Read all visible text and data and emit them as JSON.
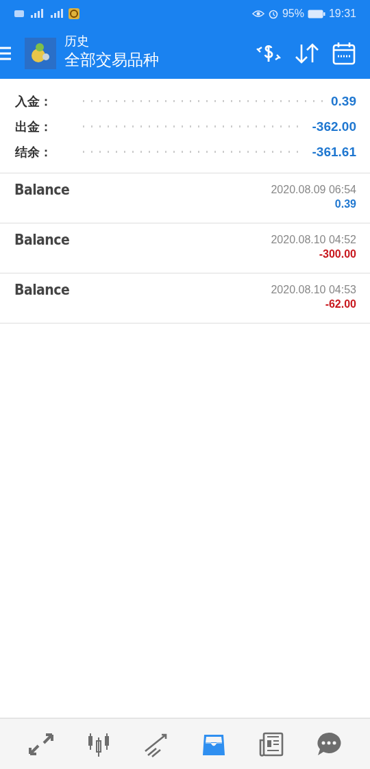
{
  "status_bar": {
    "battery": "95%",
    "time": "19:31"
  },
  "header": {
    "title": "历史",
    "subtitle": "全部交易品种"
  },
  "summary": [
    {
      "label": "入金：",
      "value": "0.39"
    },
    {
      "label": "出金：",
      "value": "-362.00"
    },
    {
      "label": "结余：",
      "value": "-361.61"
    }
  ],
  "deals": [
    {
      "name": "Balance",
      "time": "2020.08.09 06:54",
      "amount": "0.39",
      "kind": "credit"
    },
    {
      "name": "Balance",
      "time": "2020.08.10 04:52",
      "amount": "-300.00",
      "kind": "debit"
    },
    {
      "name": "Balance",
      "time": "2020.08.10 04:53",
      "amount": "-62.00",
      "kind": "debit"
    }
  ],
  "nav": [
    {
      "kind": "quotes",
      "selected": false
    },
    {
      "kind": "chart",
      "selected": false
    },
    {
      "kind": "trade",
      "selected": false
    },
    {
      "kind": "history",
      "selected": true
    },
    {
      "kind": "news",
      "selected": false
    },
    {
      "kind": "chat",
      "selected": false
    }
  ]
}
